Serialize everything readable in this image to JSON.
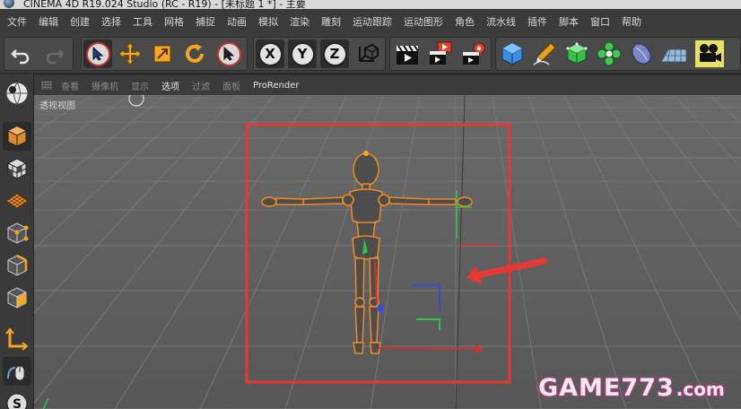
{
  "window": {
    "title": "CINEMA 4D R19.024 Studio (RC - R19) - [未标题 1 *] - 主要"
  },
  "menu": [
    "文件",
    "编辑",
    "创建",
    "选择",
    "工具",
    "网格",
    "捕捉",
    "动画",
    "模拟",
    "渲染",
    "雕刻",
    "运动跟踪",
    "运动图形",
    "角色",
    "流水线",
    "插件",
    "脚本",
    "窗口",
    "帮助"
  ],
  "toolbar": {
    "axis_x": "X",
    "axis_y": "Y",
    "axis_z": "Z"
  },
  "view_menu": [
    "查看",
    "摄像机",
    "显示",
    "选项",
    "过滤",
    "面板",
    "ProRender"
  ],
  "view_menu_active": "选项",
  "viewport": {
    "label": "透视视图"
  },
  "watermark": {
    "brand": "GAME773",
    "suffix": ".com"
  },
  "colors": {
    "selection_box": "#e53935",
    "annotation_arrow": "#e53935",
    "model_outline": "#f08a24",
    "viewport_bg": "#5c5c5c",
    "grid_line": "#6e6e6e"
  },
  "icons": {
    "undo": "undo-arrow-icon",
    "redo": "redo-arrow-icon",
    "select": "cursor-arrow-icon",
    "move": "move-cross-icon",
    "scale": "scale-box-icon",
    "rotate": "rotate-icon",
    "live_select": "cursor-arrow-icon",
    "coord": "world-coordinate-icon",
    "render_view": "clapper-icon",
    "render_picture": "clapper-red-icon",
    "render_settings": "clapper-gear-icon",
    "cube": "cube-icon",
    "pen": "pen-icon",
    "subdivision": "subdivision-cube-icon",
    "cloner": "cloner-flower-icon",
    "deformer": "deformer-icon",
    "floor": "floor-plane-icon",
    "camera": "camera-icon"
  }
}
